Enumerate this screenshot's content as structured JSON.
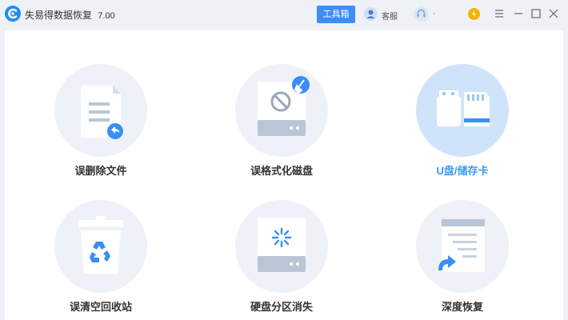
{
  "app": {
    "title": "失易得数据恢复",
    "version": "7.00"
  },
  "header": {
    "toolbox_label": "工具箱",
    "customer_service_label": "客服",
    "user_label": "-"
  },
  "tiles": [
    {
      "label": "误删除文件"
    },
    {
      "label": "误格式化磁盘"
    },
    {
      "label": "U盘/储存卡",
      "active": true
    },
    {
      "label": "误清空回收站"
    },
    {
      "label": "硬盘分区消失"
    },
    {
      "label": "深度恢复"
    }
  ],
  "colors": {
    "accent": "#3d8ef7",
    "active_label": "#3a9af2",
    "active_circle": "#cfe4fb",
    "circle": "#eef2f8"
  }
}
